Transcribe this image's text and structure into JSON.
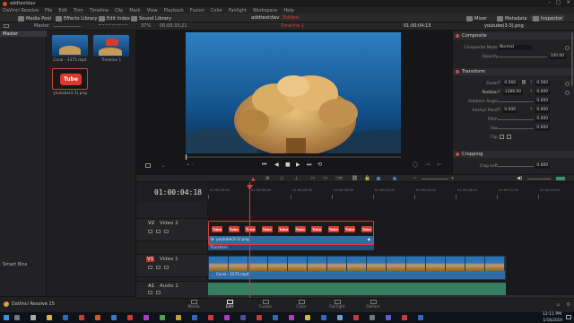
{
  "window": {
    "title": "addtextdav"
  },
  "menu": [
    "DaVinci Resolve",
    "File",
    "Edit",
    "Trim",
    "Timeline",
    "Clip",
    "Mark",
    "View",
    "Playback",
    "Fusion",
    "Color",
    "Fairlight",
    "Workspace",
    "Help"
  ],
  "toolbar": {
    "media_pool": "Media Pool",
    "effects_library": "Effects Library",
    "edit_index": "Edit Index",
    "sound_library": "Sound Library",
    "project_name": "addtextdav",
    "edited": "Edited",
    "mixer": "Mixer",
    "metadata": "Metadata",
    "inspector": "Inspector"
  },
  "subheader": {
    "bin_label": "Master",
    "zoom": "37%",
    "source_tc": "00:00:33:21",
    "timeline_name": "Timeline 1",
    "record_tc": "01:00:04:15",
    "clip_name": "youtube(3-3).png"
  },
  "bins": {
    "master": "Master",
    "smart_bins": "Smart Bins"
  },
  "media_pool": {
    "clips": [
      {
        "name": "Coral - 3375.mp4",
        "kind": "coral"
      },
      {
        "name": "Timeline 1",
        "kind": "timeline"
      },
      {
        "name": "youtube(3-3).png",
        "kind": "youtube",
        "selected": true
      }
    ]
  },
  "inspector": {
    "sections": {
      "composite": "Composite",
      "transform": "Transform",
      "cropping": "Cropping"
    },
    "props": [
      {
        "label": "Composite Mode",
        "value": "Normal"
      },
      {
        "label": "Opacity",
        "value": "100.00"
      },
      {
        "label": "Zoom",
        "x": "0.560",
        "y": "0.560"
      },
      {
        "label": "Position",
        "x": "-1286.00",
        "y": "0.000"
      },
      {
        "label": "Rotation Angle",
        "value": "0.000"
      },
      {
        "label": "Anchor Point",
        "x": "0.000",
        "y": "0.000"
      },
      {
        "label": "Pitch",
        "value": "0.000"
      },
      {
        "label": "Yaw",
        "value": "0.000"
      },
      {
        "label": "Flip",
        "value": ""
      },
      {
        "label": "Crop Left",
        "value": "0.000"
      }
    ]
  },
  "timeline": {
    "timecode": "01:00:04:18",
    "ruler_marks": [
      "01:00:00:00",
      "01:00:03:00",
      "01:00:06:00",
      "01:00:09:00",
      "01:00:12:00",
      "01:00:15:00",
      "01:00:18:00",
      "01:00:21:00",
      "01:00:24:00"
    ],
    "tracks": {
      "v2": {
        "id": "V2",
        "name": "Video 2",
        "clip": "youtube(3-3).png",
        "transform": "Transform"
      },
      "v1": {
        "id": "V1",
        "name": "Video 1",
        "clip": "Coral - 3375.mp4"
      },
      "a1": {
        "id": "A1",
        "name": "Audio 1"
      }
    },
    "thumb_label": "Tube"
  },
  "pages": [
    "Media",
    "Edit",
    "Fusion",
    "Color",
    "Fairlight",
    "Deliver"
  ],
  "active_page": "Edit",
  "status": {
    "app": "DaVinci Resolve 15"
  },
  "clock": {
    "time": "12:11 PM",
    "date": "1/16/2019"
  },
  "colors": {
    "accent_red": "#d0413a",
    "timeline_blue": "#2d6da6",
    "audio_green": "#3d8f6e",
    "active_blue": "#3a7fd0"
  }
}
